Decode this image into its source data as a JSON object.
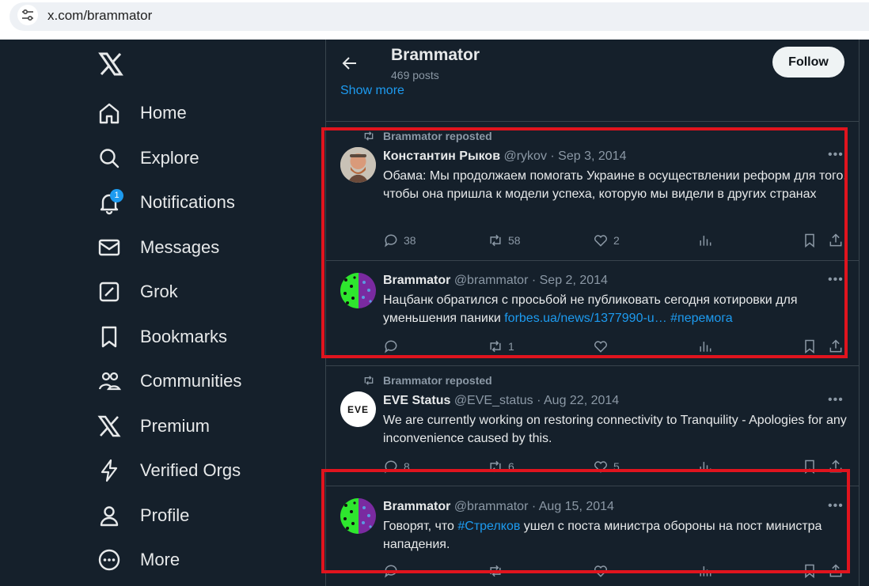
{
  "browser": {
    "url": "x.com/brammator"
  },
  "sidebar": {
    "items": [
      {
        "label": "Home"
      },
      {
        "label": "Explore"
      },
      {
        "label": "Notifications",
        "badge": "1"
      },
      {
        "label": "Messages"
      },
      {
        "label": "Grok"
      },
      {
        "label": "Bookmarks"
      },
      {
        "label": "Communities"
      },
      {
        "label": "Premium"
      },
      {
        "label": "Verified Orgs"
      },
      {
        "label": "Profile"
      },
      {
        "label": "More"
      }
    ]
  },
  "header": {
    "title": "Brammator",
    "posts": "469 posts",
    "follow": "Follow",
    "show_more": "Show more"
  },
  "repost_label": "Brammator reposted",
  "tweets": [
    {
      "name": "Константин Рыков",
      "meta": "@rykov · Sep 3, 2014",
      "text": "Обама: Мы продолжаем помогать Украине в осуществлении реформ для того, чтобы она пришла к модели успеха, которую мы видели в других странах",
      "replies": "38",
      "reposts": "58",
      "likes": "2"
    },
    {
      "name": "Brammator",
      "meta": "@brammator · Sep 2, 2014",
      "text": "Нацбанк обратился с просьбой не публиковать сегодня котировки для уменьшения паники ",
      "link": "forbes.ua/news/1377990-u…",
      "hashtag": "#перемога",
      "replies": "",
      "reposts": "1",
      "likes": ""
    },
    {
      "name": "EVE Status",
      "meta": "@EVE_status · Aug 22, 2014",
      "text": "We are currently working on restoring connectivity to Tranquility - Apologies for any inconvenience caused by this.",
      "avatar_text": "EVE",
      "replies": "8",
      "reposts": "6",
      "likes": "5"
    },
    {
      "name": "Brammator",
      "meta": "@brammator · Aug 15, 2014",
      "text_before": "Говорят, что ",
      "hashtag": "#Стрелков",
      "text_after": " ушел с поста министра обороны на пост министра нападения."
    }
  ],
  "colors": {
    "background": "#15202b",
    "accent": "#1d9bf0",
    "highlight_box": "#e0141e"
  }
}
